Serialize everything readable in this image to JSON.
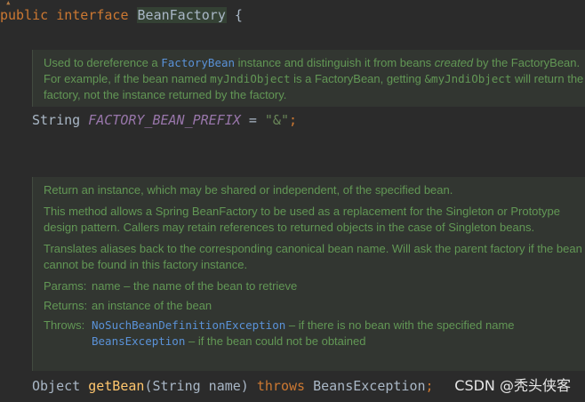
{
  "line1": {
    "public": "public",
    "interface": "interface",
    "name": "BeanFactory",
    "brace": "{"
  },
  "doc1": {
    "t1": "Used to dereference a ",
    "link1": "FactoryBean",
    "t2": " instance and distinguish it from beans ",
    "em": "created",
    "t3": " by the FactoryBean. For example, if the bean named ",
    "mono1": "myJndiObject",
    "t4": " is a FactoryBean, getting ",
    "mono2": "&myJndiObject",
    "t5": " will return the factory, not the instance returned by the factory."
  },
  "field": {
    "type": "String",
    "name": "FACTORY_BEAN_PREFIX",
    "eq": " = ",
    "value": "\"&\"",
    "semi": ";"
  },
  "doc2": {
    "p1": "Return an instance, which may be shared or independent, of the specified bean.",
    "p2": "This method allows a Spring BeanFactory to be used as a replacement for the Singleton or Prototype design pattern. Callers may retain references to returned objects in the case of Singleton beans.",
    "p3": "Translates aliases back to the corresponding canonical bean name. Will ask the parent factory if the bean cannot be found in this factory instance.",
    "params_label": "Params:",
    "params_text": "name – the name of the bean to retrieve",
    "returns_label": "Returns:",
    "returns_text": "an instance of the bean",
    "throws_label": "Throws:",
    "throws1_link": "NoSuchBeanDefinitionException",
    "throws1_text": " – if there is no bean with the specified name",
    "throws2_link": "BeansException",
    "throws2_text": " – if the bean could not be obtained"
  },
  "method": {
    "ret": "Object",
    "name": "getBean",
    "params": "(String name) ",
    "throws": "throws",
    "exc": " BeansException",
    "semi": ";"
  },
  "watermark": "CSDN @秃头侠客"
}
